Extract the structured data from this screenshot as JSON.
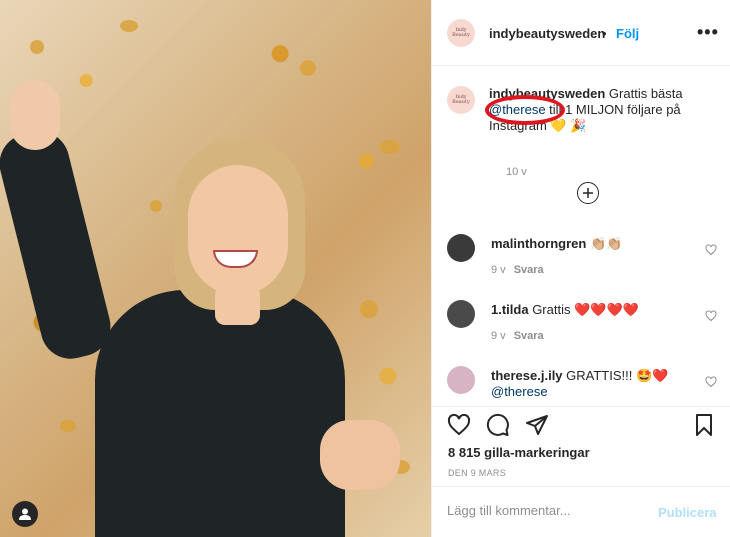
{
  "post": {
    "account": "indybeautysweden",
    "dot": "•",
    "follow_label": "Följ",
    "more_label": "•••",
    "avatar_text": "Indy Beauty"
  },
  "caption": {
    "username": "indybeautysweden",
    "text_part1": " Grattis bästa ",
    "mention": "@therese",
    "text_part2": " till 1 MILJON följare på Instagram",
    "emojis": " 💛 🎉",
    "time": "10 v"
  },
  "comments": [
    {
      "username": "malinthorngren",
      "text": " 👏🏼👏🏼",
      "time": "9 v",
      "reply": "Svara",
      "avatar_color": "#3a3a3a"
    },
    {
      "username": "1.tilda",
      "text": " Grattis ❤️❤️❤️❤️",
      "time": "9 v",
      "reply": "Svara",
      "avatar_color": "#4a4a4a"
    },
    {
      "username": "therese.j.ily",
      "text": " GRATTIS!!! 🤩❤️",
      "mention": "@therese",
      "time": "9 v",
      "reply": "Svara",
      "avatar_color": "#d7b4c4"
    }
  ],
  "actions": {
    "likes": "8 815 gilla-markeringar",
    "date": "DEN 9 MARS"
  },
  "add_comment": {
    "placeholder": "Lägg till kommentar...",
    "publish_label": "Publicera"
  },
  "colors": {
    "link": "#0095f6",
    "publish_disabled": "#b2dffc",
    "annotation_circle": "#e0161f"
  }
}
